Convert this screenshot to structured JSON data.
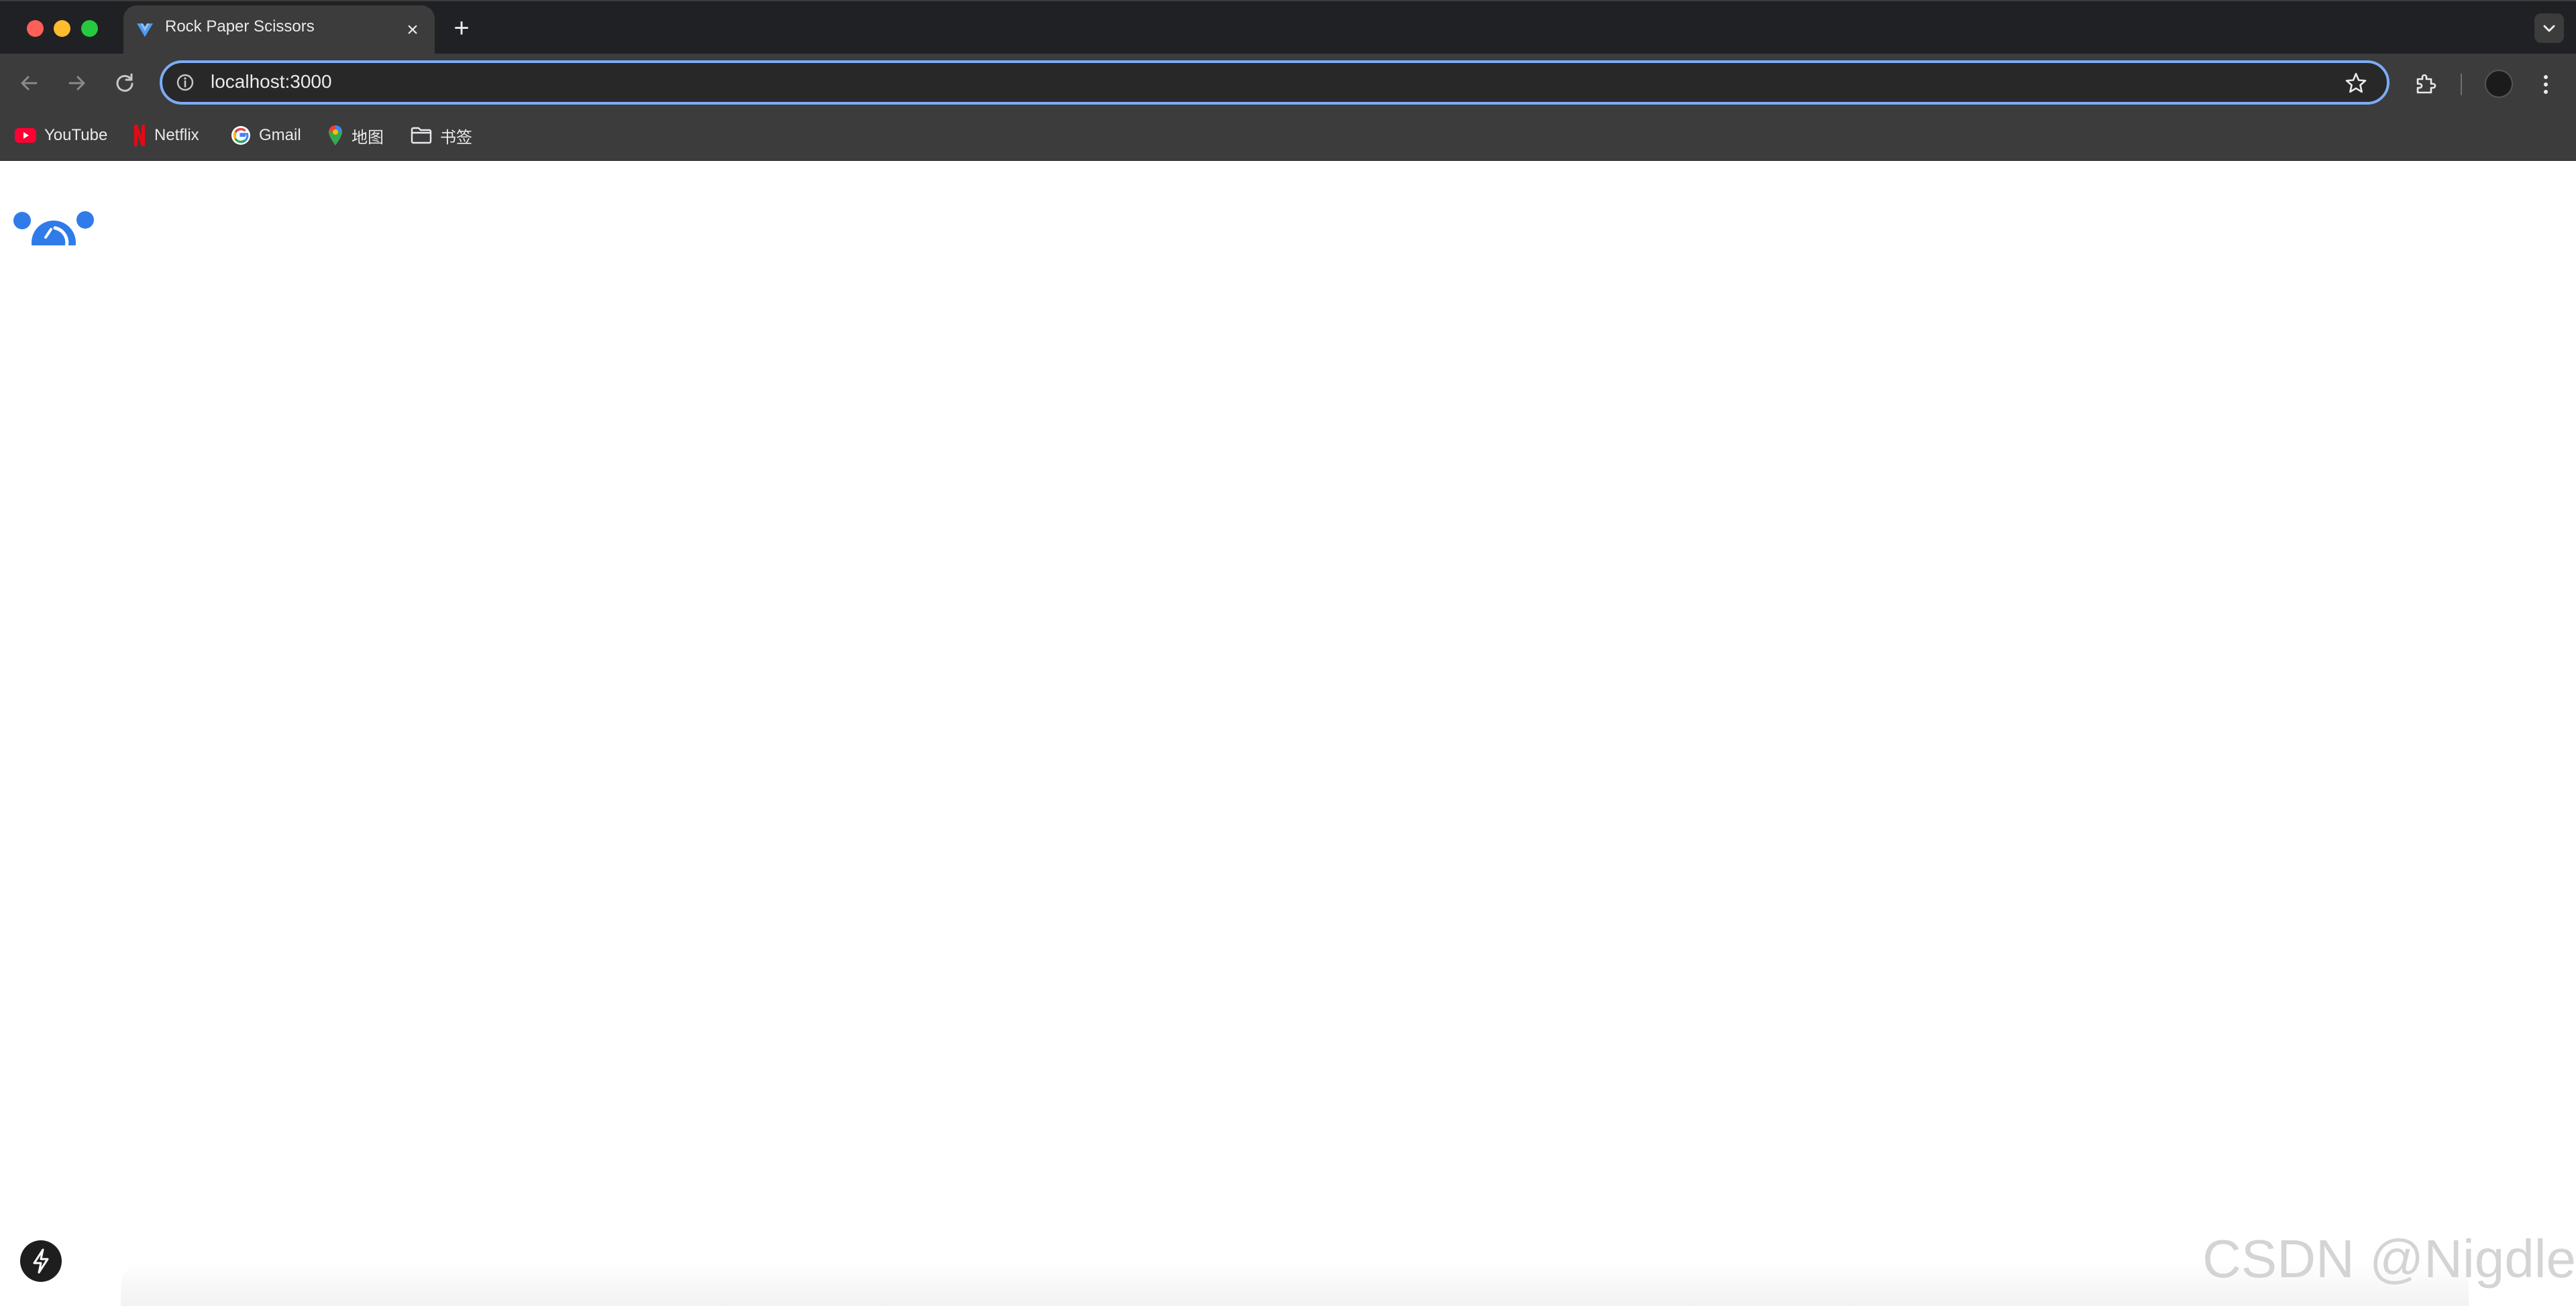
{
  "tab": {
    "title": "Rock Paper Scissors",
    "close_symbol": "×"
  },
  "new_tab_symbol": "+",
  "address_bar": {
    "url": "localhost:3000"
  },
  "bookmarks": [
    {
      "label": "YouTube",
      "icon": "youtube-icon"
    },
    {
      "label": "Netflix",
      "icon": "netflix-icon"
    },
    {
      "label": "Gmail",
      "icon": "google-icon"
    },
    {
      "label": "地图",
      "icon": "maps-icon"
    },
    {
      "label": "书签",
      "icon": "folder-icon"
    }
  ],
  "watermark": "CSDN @Nigdle",
  "colors": {
    "accent": "#7cacf8",
    "loader_blue": "#2f7bea",
    "tab_strip": "#202124",
    "toolbar": "#3c3c3c"
  }
}
